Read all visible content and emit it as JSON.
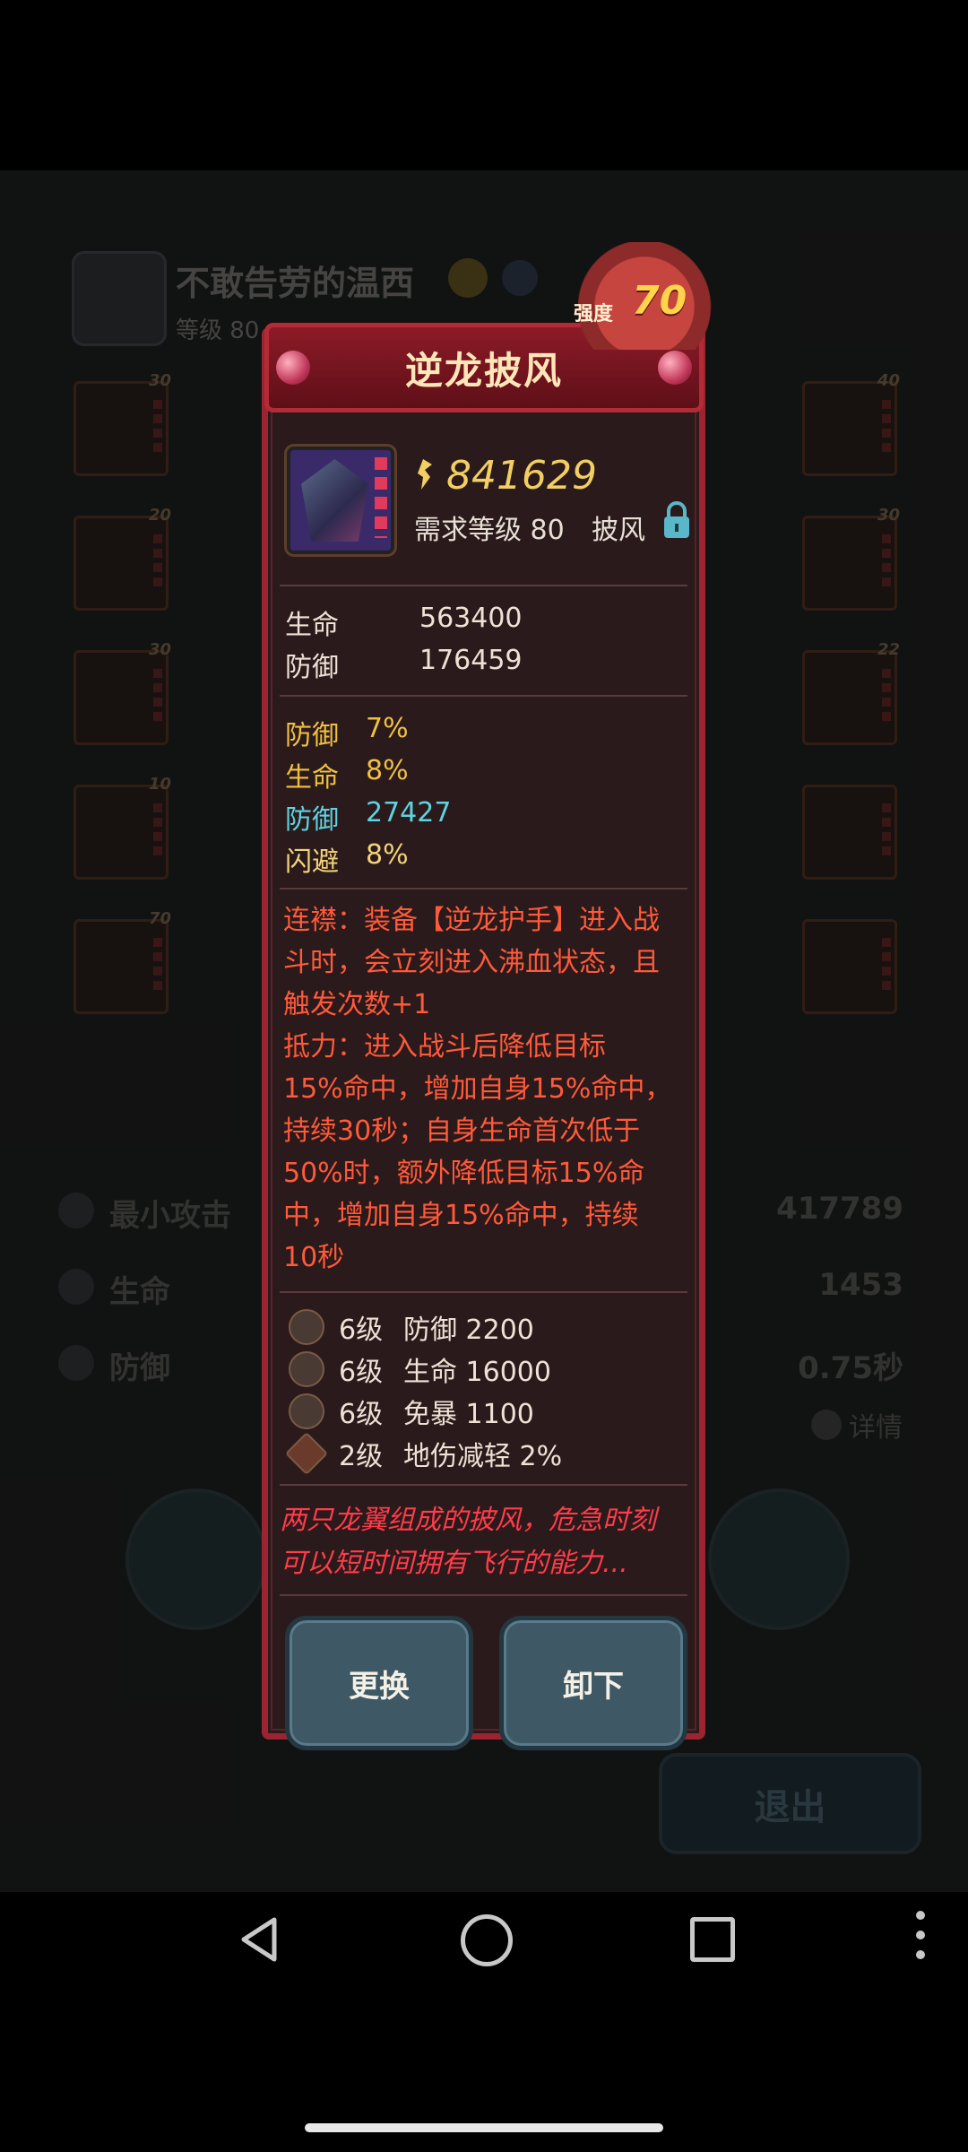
{
  "background": {
    "player_name": "不敢告劳的温西",
    "player_level": "等级 80",
    "slots_left": [
      "30",
      "20",
      "30",
      "10",
      "70"
    ],
    "slots_right": [
      "40",
      "30",
      "22",
      "",
      ""
    ],
    "stats": [
      {
        "label": "最小攻击",
        "value": "417789",
        "icon": "sword-icon"
      },
      {
        "label": "生命",
        "value": "1453",
        "icon": "heart-icon"
      },
      {
        "label": "防御",
        "value": "0.75秒",
        "icon": "shield-icon"
      }
    ],
    "details_label": "详情",
    "exit_label": "退出"
  },
  "modal": {
    "title": "逆龙披风",
    "strength_label": "强度",
    "strength_value": "70",
    "power": "841629",
    "requirement": "需求等级 80",
    "slot_type": "披风",
    "base_stats": [
      {
        "label": "生命",
        "value": "563400"
      },
      {
        "label": "防御",
        "value": "176459"
      }
    ],
    "bonus_stats": [
      {
        "label": "防御",
        "value": "7%",
        "color": "#f0c040"
      },
      {
        "label": "生命",
        "value": "8%",
        "color": "#f0c040"
      },
      {
        "label": "防御",
        "value": "27427",
        "color": "#5fd3e0"
      },
      {
        "label": "闪避",
        "value": "8%",
        "color": "#f2d37a"
      }
    ],
    "description_lines": [
      "连襟：装备【逆龙护手】进入战",
      "斗时，会立刻进入沸血状态，且",
      "触发次数+1",
      "抵力：进入战斗后降低目标",
      "15%命中，增加自身15%命中，",
      "持续30秒；自身生命首次低于",
      "50%时，额外降低目标15%命",
      "中，增加自身15%命中，持续",
      "10秒"
    ],
    "runes": [
      {
        "level": "6级",
        "effect": "防御 2200"
      },
      {
        "level": "6级",
        "effect": "生命 16000"
      },
      {
        "level": "6级",
        "effect": "免暴 1100"
      },
      {
        "level": "2级",
        "effect": "地伤减轻 2%"
      }
    ],
    "flavor_lines": [
      "两只龙翼组成的披风，危急时刻",
      "可以短时间拥有飞行的能力..."
    ],
    "replace_label": "更换",
    "unequip_label": "卸下"
  }
}
